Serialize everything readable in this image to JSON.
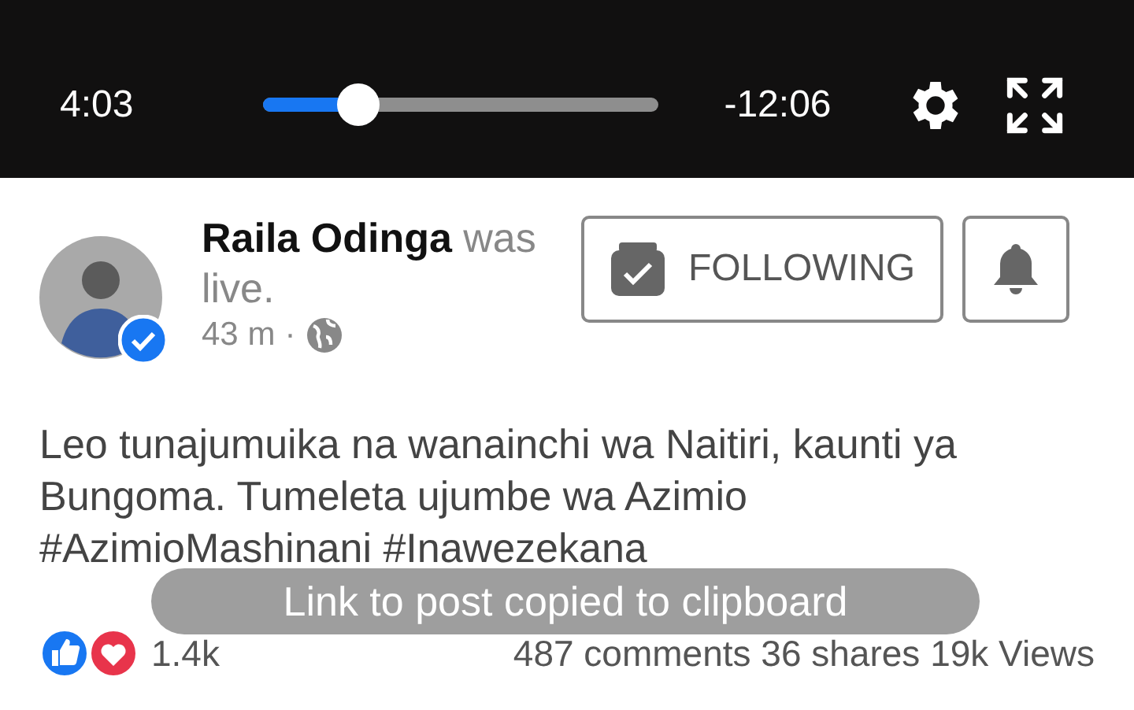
{
  "video": {
    "elapsed": "4:03",
    "level": 0.24,
    "remaining": "-12:06"
  },
  "post": {
    "author": "Raila Odinga",
    "action": "was live.",
    "verified": true,
    "time": "43 m",
    "separator": "·",
    "follow_label": "FOLLOWING",
    "text": "Leo tunajumuika na wanainchi wa Naitiri, kaunti ya Bungoma. Tumeleta ujumbe wa Azimio #AzimioMashinani #Inawezekana",
    "reactions": "1.4k",
    "comments": "487 comments",
    "shares": "36 shares",
    "views": "19k Views"
  },
  "toast": "Link to post copied to clipboard"
}
